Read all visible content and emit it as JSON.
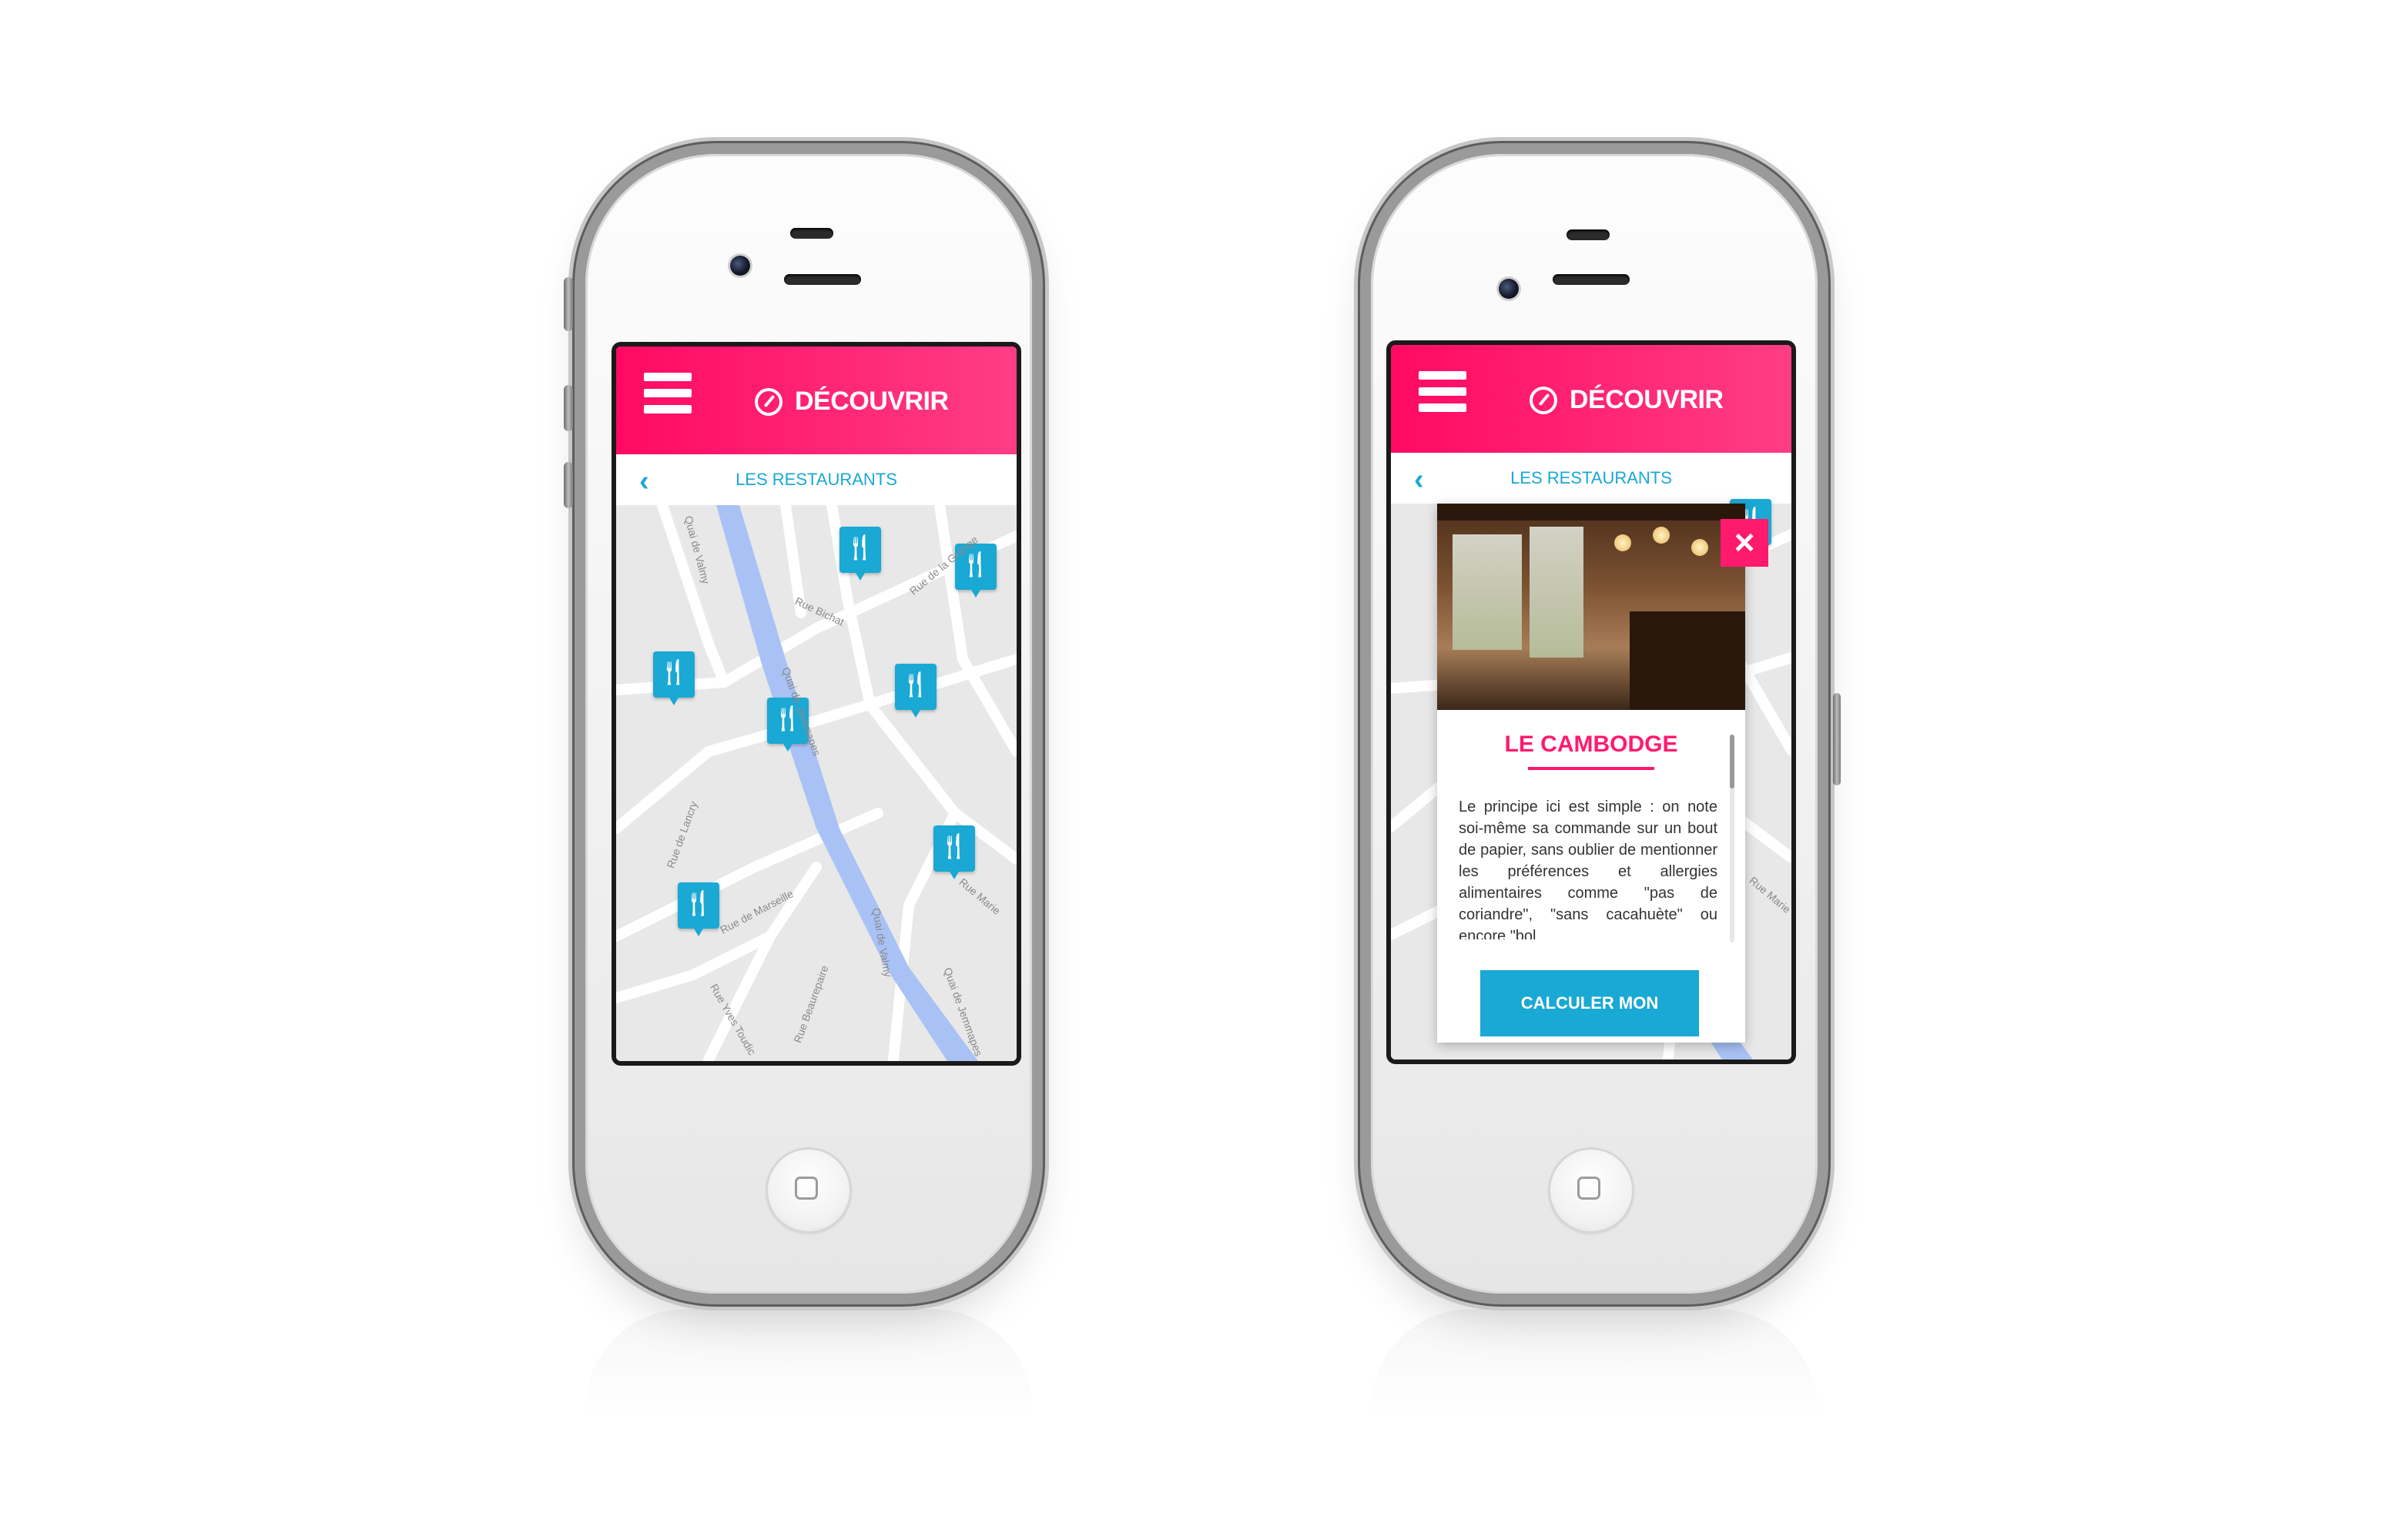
{
  "colors": {
    "accent_pink": "#ff0a63",
    "accent_blue": "#1aa8d4",
    "map_bg": "#e8e8e8",
    "water": "#a9c2f5"
  },
  "phone_left": {
    "header": {
      "menu_icon": "hamburger-icon",
      "compass_icon": "compass-icon",
      "title": "DÉCOUVRIR"
    },
    "subheader": {
      "back_icon": "chevron-left-icon",
      "label": "LES RESTAURANTS"
    },
    "map": {
      "streets": [
        "Rue Bichat",
        "Quai de Jemmapes",
        "Rue de la Grange",
        "Quai de Valmy",
        "Rue de Lancry",
        "Rue de Marseille",
        "Rue Beaurepaire",
        "Rue Yves Toudic",
        "Quai de Jemmapes",
        "Quai de Valmy",
        "Rue Marie"
      ],
      "markers": [
        "restaurant-marker",
        "restaurant-marker",
        "restaurant-marker",
        "restaurant-marker",
        "restaurant-marker",
        "restaurant-marker",
        "restaurant-marker"
      ]
    }
  },
  "phone_right": {
    "header": {
      "menu_icon": "hamburger-icon",
      "compass_icon": "compass-icon",
      "title": "DÉCOUVRIR"
    },
    "subheader": {
      "back_icon": "chevron-left-icon",
      "label": "LES RESTAURANTS"
    },
    "card": {
      "close_icon": "close-icon",
      "name": "LE CAMBODGE",
      "description": "Le principe ici est simple : on note soi-même sa commande sur un bout de papier, sans oublier de mentionner les préférences et allergies alimentaires comme \"pas de coriandre\", \"sans cacahuète\" ou encore \"bol",
      "cta": "CALCULER MON ITINÉRAIRE"
    },
    "map": {
      "streets": [
        "Rue Marie"
      ]
    }
  }
}
